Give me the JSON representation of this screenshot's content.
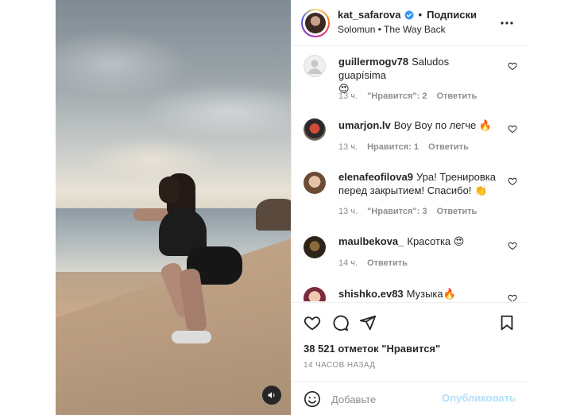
{
  "post": {
    "username": "kat_safarova",
    "separator": "•",
    "follow_label": "Подписки",
    "audio": "Solomun • The Way Back"
  },
  "comments": [
    {
      "user": "guillermogv78",
      "text": "Saludos guapísima",
      "emoji": "😍",
      "time": "13 ч.",
      "likes": "\"Нравится\": 2",
      "reply": "Ответить"
    },
    {
      "user": "umarjon.lv",
      "text": "Boy Boy по легче",
      "emoji": "🔥",
      "time": "13 ч.",
      "likes": "Нравится: 1",
      "reply": "Ответить"
    },
    {
      "user": "elenafeofilova9",
      "text": "Ура! Тренировка перед закрытием! Спасибо!",
      "emoji": "👏",
      "time": "13 ч.",
      "likes": "\"Нравится\": 3",
      "reply": "Ответить"
    },
    {
      "user": "maulbekova_",
      "text": "Красотка",
      "emoji": "😍",
      "time": "14 ч.",
      "likes": "",
      "reply": "Ответить"
    },
    {
      "user": "shishko.ev83",
      "text": "Музыка",
      "emoji": "🔥",
      "time": "",
      "likes": "",
      "reply": ""
    }
  ],
  "likes_count": "38 521 отметок \"Нравится\"",
  "time_ago": "14 ЧАСОВ НАЗАД",
  "add_comment": {
    "placeholder": "Добавьте",
    "publish_label": "Опубликовать"
  },
  "colors": {
    "verified": "#3897f0",
    "publish_disabled": "#b2dffc",
    "meta_gray": "#8e8e8e"
  }
}
